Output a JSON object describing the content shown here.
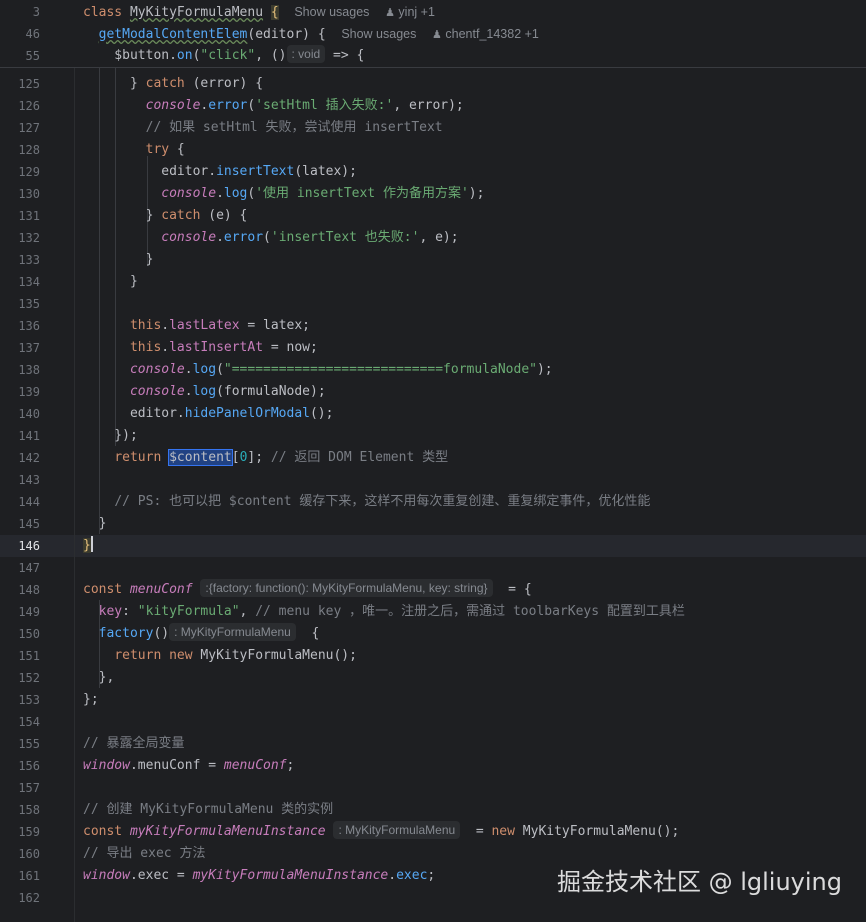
{
  "sticky": [
    {
      "num": "3"
    },
    {
      "num": "46"
    },
    {
      "num": "55"
    }
  ],
  "hints": {
    "show_usages": "Show usages",
    "author1": "yinj +1",
    "author2": "chentf_14382 +1",
    "void_hint": ": void",
    "menuconf_hint": ":{factory: function(): MyKityFormulaMenu, key: string}",
    "factory_hint": ": MyKityFormulaMenu",
    "instance_hint": ": MyKityFormulaMenu"
  },
  "line_numbers": [
    "125",
    "126",
    "127",
    "128",
    "129",
    "130",
    "131",
    "132",
    "133",
    "134",
    "135",
    "136",
    "137",
    "138",
    "139",
    "140",
    "141",
    "142",
    "143",
    "144",
    "145",
    "146",
    "147",
    "148",
    "149",
    "150",
    "151",
    "152",
    "153",
    "154",
    "155",
    "156",
    "157",
    "158",
    "159",
    "160",
    "161",
    "162"
  ],
  "strings": {
    "s126": "'setHtml 插入失败:'",
    "c127": "// 如果 setHtml 失败，尝试使用 insertText",
    "s130": "'使用 insertText 作为备用方案'",
    "s132": "'insertText 也失败:'",
    "s139": "\"===========================formulaNode\"",
    "c143": "// 返回 DOM Element 类型",
    "c145": "// PS: 也可以把 $content 缓存下来，这样不用每次重复创建、重复绑定事件，优化性能",
    "s150": "\"kityFormula\"",
    "c150": "// menu key ，唯一。注册之后，需通过 toolbarKeys 配置到工具栏",
    "c156": "// 暴露全局变量",
    "c159": "// 创建 MyKityFormulaMenu 类的实例",
    "c161": "// 导出 exec 方法",
    "click": "\"click\""
  },
  "watermark": "掘金技术社区 @ lgliuying"
}
